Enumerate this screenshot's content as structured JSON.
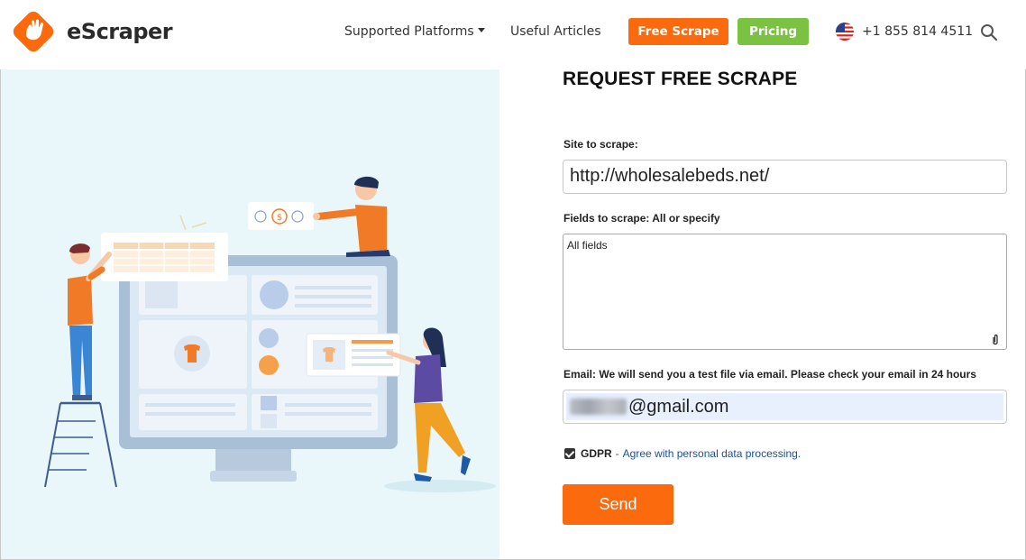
{
  "header": {
    "brand": "eScraper",
    "nav": {
      "platforms_label": "Supported Platforms",
      "articles_label": "Useful Articles"
    },
    "free_scrape_label": "Free Scrape",
    "pricing_label": "Pricing",
    "phone": "+1 855 814 4511"
  },
  "form": {
    "title": "REQUEST FREE SCRAPE",
    "site_label": "Site to scrape:",
    "site_value": "http://wholesalebeds.net/",
    "fields_label": "Fields to scrape: All or specify",
    "fields_value": "All fields",
    "email_label": "Email: We will send you a test file via email. Please check your email in 24 hours",
    "email_domain": "@gmail.com",
    "gdpr_label": "GDPR",
    "gdpr_link": "Agree with personal data processing.",
    "gdpr_checked": true,
    "send_label": "Send"
  },
  "colors": {
    "brand_orange": "#fb6a0c",
    "pricing_green": "#7cc242",
    "illustration_bg": "#e9f6fa",
    "link_blue": "#1a4f9c"
  },
  "icons": {
    "logo": "hand-logo-icon",
    "flag": "us-flag-icon",
    "search": "search-icon",
    "attachment": "paperclip-icon",
    "checkbox": "checkbox-checked-icon"
  }
}
